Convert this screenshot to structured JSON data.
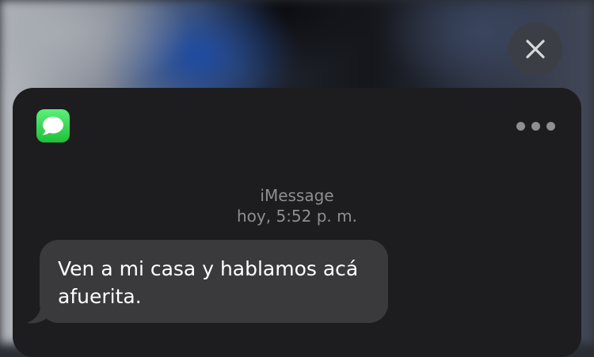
{
  "header": {
    "app_icon": "messages-app-icon",
    "close_icon": "close-icon",
    "more_icon": "ellipsis-icon"
  },
  "conversation": {
    "service_label": "iMessage",
    "timestamp": "hoy, 5:52 p. m.",
    "messages": [
      {
        "direction": "incoming",
        "text": "Ven a mi casa y hablamos acá afuerita."
      }
    ]
  },
  "colors": {
    "card_bg": "#1d1d1f",
    "bubble_bg": "#3a3a3d",
    "meta_text": "#8e8e93",
    "app_icon_green": "#34c759"
  }
}
